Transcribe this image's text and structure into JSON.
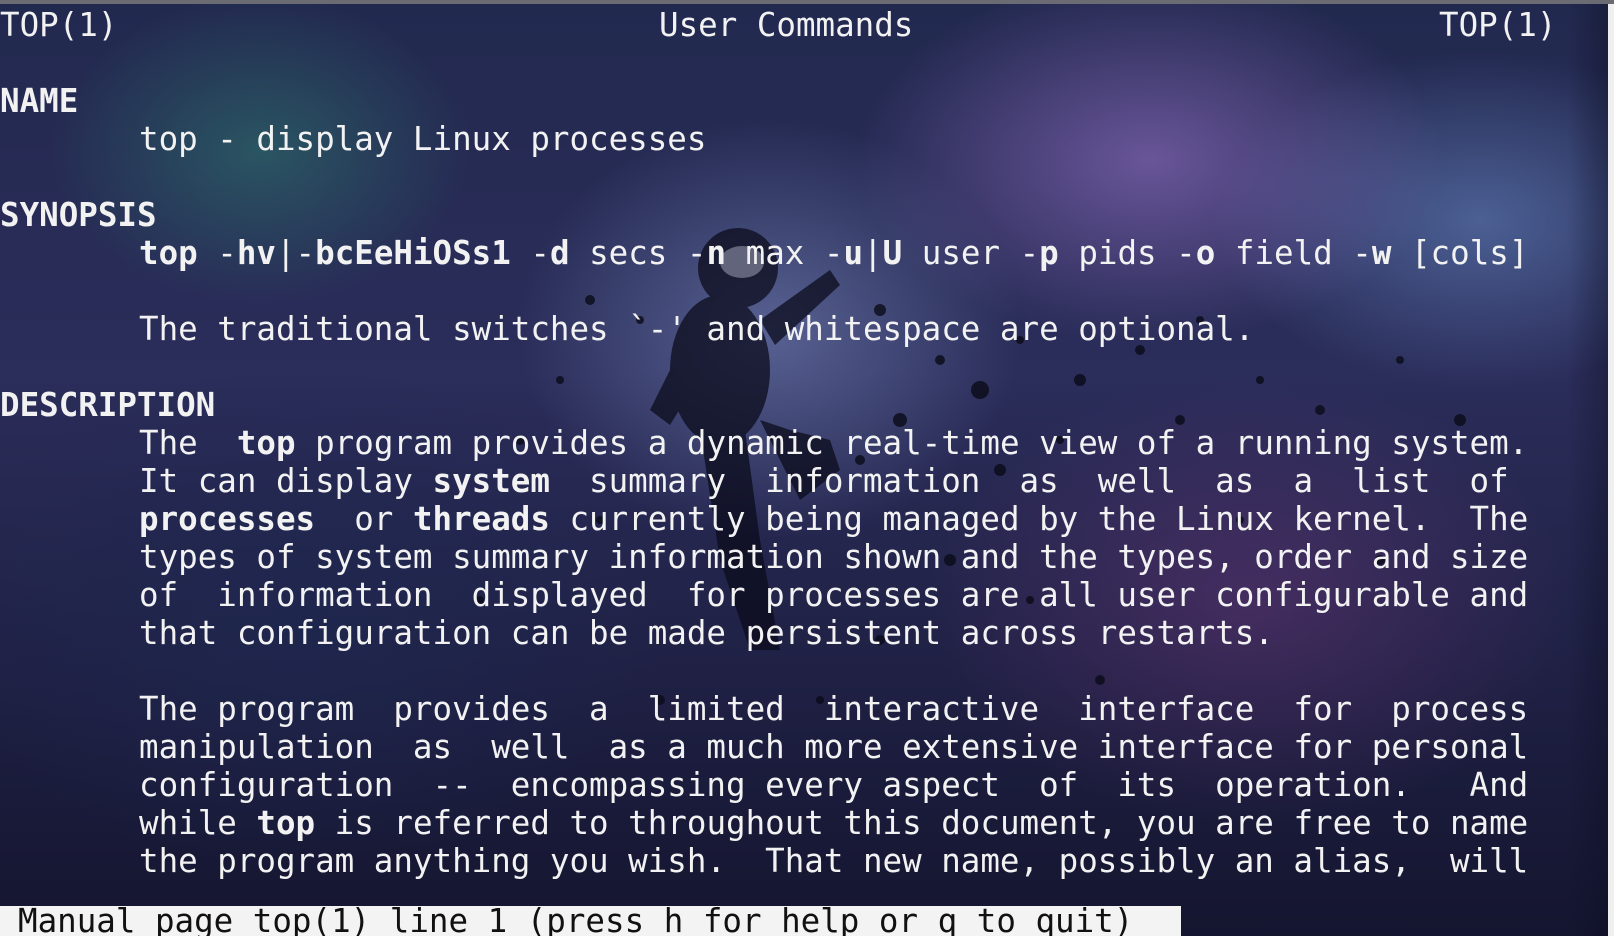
{
  "header": {
    "left": "TOP(1)",
    "center": "User Commands",
    "right": "TOP(1)"
  },
  "sections": {
    "name": {
      "heading": "NAME",
      "body": "top - display Linux processes"
    },
    "synopsis": {
      "heading": "SYNOPSIS",
      "cmd": "top",
      "seg1": " -",
      "opt_hv": "hv",
      "pipe1": "|-",
      "opt_flags": "bcEeHiOSs1",
      "sp1": " -",
      "opt_d": "d",
      "arg_d": " secs -",
      "opt_n": "n",
      "arg_n": " max -",
      "opt_u": "u",
      "pipe2": "|",
      "opt_U": "U",
      "arg_u": " user -",
      "opt_p": "p",
      "arg_p": " pids -",
      "opt_o": "o",
      "arg_o": " field -",
      "opt_w": "w",
      "arg_w": " [cols]",
      "note": "The traditional switches `-' and whitespace are optional."
    },
    "description": {
      "heading": "DESCRIPTION",
      "p1_l1_a": "The  ",
      "p1_l1_b": "top",
      "p1_l1_c": " program provides a dynamic real-time view of a running system.",
      "p1_l2_a": "It can display ",
      "p1_l2_b": "system",
      "p1_l2_c": "  summary  information  as  well  as  a  list  of",
      "p1_l3_a": "processes",
      "p1_l3_b": "  or ",
      "p1_l3_c": "threads",
      "p1_l3_d": " currently being managed by the Linux kernel.  The",
      "p1_l4": "types of system summary information shown and the types, order and size",
      "p1_l5": "of  information  displayed  for processes are all user configurable and",
      "p1_l6": "that configuration can be made persistent across restarts.",
      "p2_l1": "The program  provides  a  limited  interactive  interface  for  process",
      "p2_l2": "manipulation  as  well  as a much more extensive interface for personal",
      "p2_l3": "configuration  --  encompassing every aspect  of  its  operation.   And",
      "p2_l4_a": "while ",
      "p2_l4_b": "top",
      "p2_l4_c": " is referred to throughout this document, you are free to name",
      "p2_l5": "the program anything you wish.  That new name, possibly an alias,  will"
    }
  },
  "status_bar": "Manual page top(1) line 1 (press h for help or q to quit)",
  "colors": {
    "text": "#f2f2f2",
    "status_bg": "#f3f3f3",
    "status_fg": "#111111"
  }
}
